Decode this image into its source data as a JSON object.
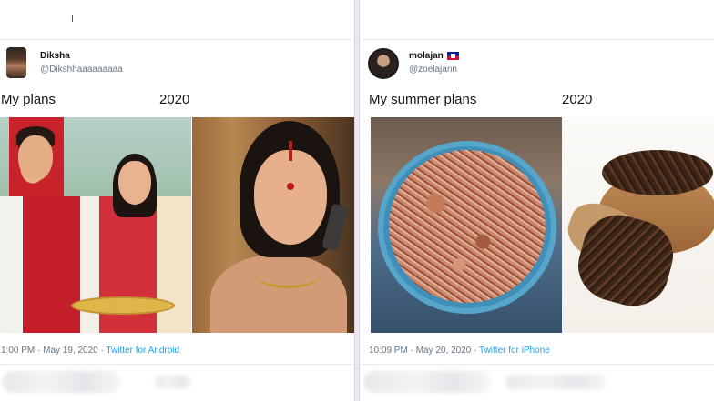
{
  "tweets": [
    {
      "user": {
        "name": "Diksha",
        "handle": "@Dikshhaaaaaaaaa"
      },
      "text_left": "My plans",
      "text_right": "2020",
      "images": [
        "photo-couple",
        "photo-phone"
      ],
      "time": "1:00 PM",
      "date": "May 19, 2020",
      "separator": " · ",
      "source": "Twitter for Android"
    },
    {
      "user": {
        "name": "molajan",
        "handle": "@zoelajann"
      },
      "text_left": "My summer plans",
      "text_right": "2020",
      "images": [
        "photo-rice",
        "photo-cloves"
      ],
      "time": "10:09 PM",
      "date": "May 20, 2020",
      "separator": " · ",
      "source": "Twitter for iPhone"
    }
  ],
  "colors": {
    "link": "#1da1f2",
    "muted": "#657786",
    "text": "#14171a",
    "background": "#ece7f3"
  },
  "icons": [
    "flag-icon"
  ]
}
